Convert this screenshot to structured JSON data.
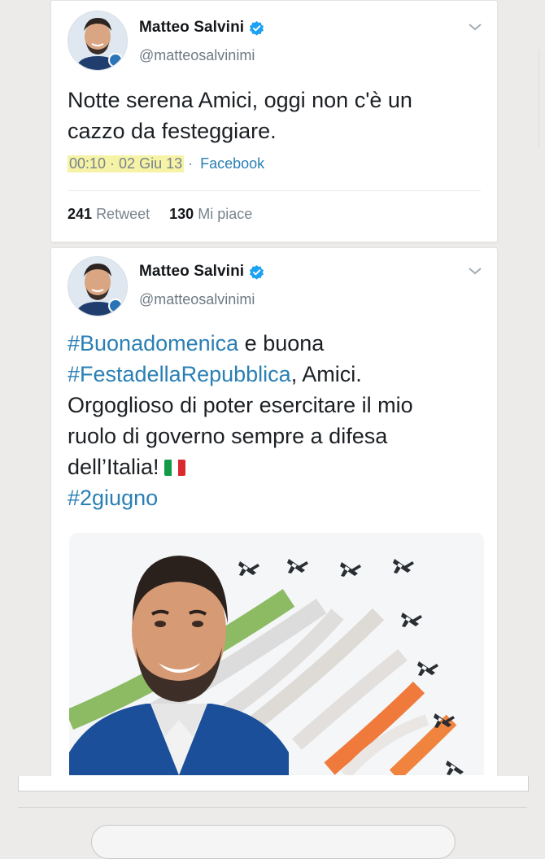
{
  "colors": {
    "link": "#2a7fb4",
    "timestamp_highlight": "#f6f3a6",
    "verified": "#1da1f2",
    "flag": [
      "#129a47",
      "#ffffff",
      "#d8292f"
    ]
  },
  "tweets": [
    {
      "author": {
        "name": "Matteo Salvini",
        "handle": "@matteosalvinimi",
        "verified": true,
        "avatar_icon": "profile-photo"
      },
      "text": "Notte serena Amici, oggi non c'è un cazzo da festeggiare.",
      "time": "00:10 · 02 Giu 13",
      "separator": " · ",
      "source": "Facebook",
      "stats": {
        "retweets": "241",
        "retweets_label": "Retweet",
        "likes": "130",
        "likes_label": "Mi piace"
      }
    },
    {
      "author": {
        "name": "Matteo Salvini",
        "handle": "@matteosalvinimi",
        "verified": true,
        "avatar_icon": "profile-photo"
      },
      "parts": {
        "hashtag1": "#Buonadomenica",
        "text1": " e buona",
        "hashtag2": "#FestadellaRepubblica",
        "text2": ", Amici.",
        "line3": "Orgoglioso di poter esercitare il mio",
        "line4": "ruolo di governo sempre a difesa",
        "line5": "dell’Italia!",
        "hashtag3": "#2giugno"
      },
      "media_icon": "photo-salvini-frecce-tricolori"
    }
  ]
}
